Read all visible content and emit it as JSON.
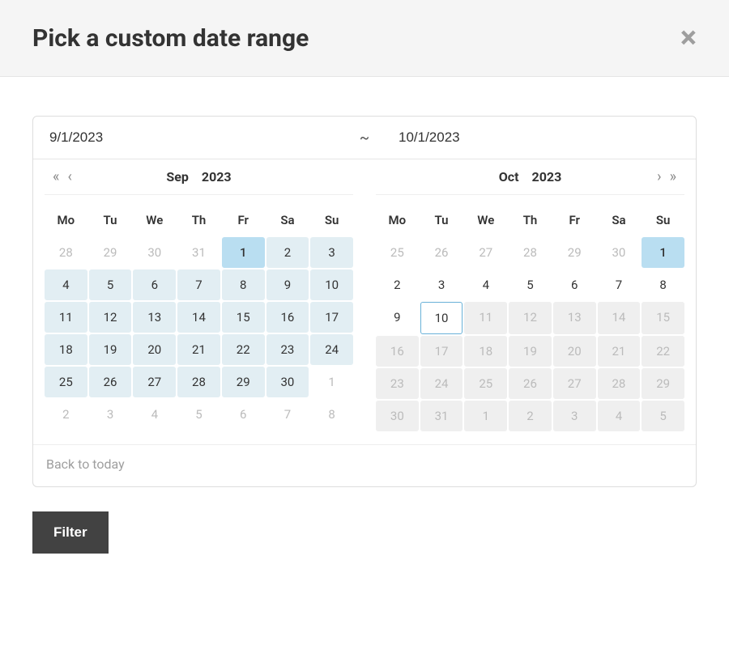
{
  "header": {
    "title": "Pick a custom date range",
    "close_glyph": "×"
  },
  "picker": {
    "start_value": "9/1/2023",
    "end_value": "10/1/2023",
    "separator": "~",
    "back_to_today": "Back to today"
  },
  "dow": [
    "Mo",
    "Tu",
    "We",
    "Th",
    "Fr",
    "Sa",
    "Su"
  ],
  "left_calendar": {
    "month": "Sep",
    "year": "2023",
    "nav_prev_year": "«",
    "nav_prev_month": "‹",
    "days": [
      {
        "n": "28",
        "cls": "other"
      },
      {
        "n": "29",
        "cls": "other"
      },
      {
        "n": "30",
        "cls": "other"
      },
      {
        "n": "31",
        "cls": "other"
      },
      {
        "n": "1",
        "cls": "selected"
      },
      {
        "n": "2",
        "cls": "in-range"
      },
      {
        "n": "3",
        "cls": "in-range"
      },
      {
        "n": "4",
        "cls": "in-range"
      },
      {
        "n": "5",
        "cls": "in-range"
      },
      {
        "n": "6",
        "cls": "in-range"
      },
      {
        "n": "7",
        "cls": "in-range"
      },
      {
        "n": "8",
        "cls": "in-range"
      },
      {
        "n": "9",
        "cls": "in-range"
      },
      {
        "n": "10",
        "cls": "in-range"
      },
      {
        "n": "11",
        "cls": "in-range"
      },
      {
        "n": "12",
        "cls": "in-range"
      },
      {
        "n": "13",
        "cls": "in-range"
      },
      {
        "n": "14",
        "cls": "in-range"
      },
      {
        "n": "15",
        "cls": "in-range"
      },
      {
        "n": "16",
        "cls": "in-range"
      },
      {
        "n": "17",
        "cls": "in-range"
      },
      {
        "n": "18",
        "cls": "in-range"
      },
      {
        "n": "19",
        "cls": "in-range"
      },
      {
        "n": "20",
        "cls": "in-range"
      },
      {
        "n": "21",
        "cls": "in-range"
      },
      {
        "n": "22",
        "cls": "in-range"
      },
      {
        "n": "23",
        "cls": "in-range"
      },
      {
        "n": "24",
        "cls": "in-range"
      },
      {
        "n": "25",
        "cls": "in-range"
      },
      {
        "n": "26",
        "cls": "in-range"
      },
      {
        "n": "27",
        "cls": "in-range"
      },
      {
        "n": "28",
        "cls": "in-range"
      },
      {
        "n": "29",
        "cls": "in-range"
      },
      {
        "n": "30",
        "cls": "in-range"
      },
      {
        "n": "1",
        "cls": "other"
      },
      {
        "n": "2",
        "cls": "other"
      },
      {
        "n": "3",
        "cls": "other"
      },
      {
        "n": "4",
        "cls": "other"
      },
      {
        "n": "5",
        "cls": "other"
      },
      {
        "n": "6",
        "cls": "other"
      },
      {
        "n": "7",
        "cls": "other"
      },
      {
        "n": "8",
        "cls": "other"
      }
    ]
  },
  "right_calendar": {
    "month": "Oct",
    "year": "2023",
    "nav_next_month": "›",
    "nav_next_year": "»",
    "days": [
      {
        "n": "25",
        "cls": "other"
      },
      {
        "n": "26",
        "cls": "other"
      },
      {
        "n": "27",
        "cls": "other"
      },
      {
        "n": "28",
        "cls": "other"
      },
      {
        "n": "29",
        "cls": "other"
      },
      {
        "n": "30",
        "cls": "other"
      },
      {
        "n": "1",
        "cls": "selected"
      },
      {
        "n": "2",
        "cls": ""
      },
      {
        "n": "3",
        "cls": ""
      },
      {
        "n": "4",
        "cls": ""
      },
      {
        "n": "5",
        "cls": ""
      },
      {
        "n": "6",
        "cls": ""
      },
      {
        "n": "7",
        "cls": ""
      },
      {
        "n": "8",
        "cls": ""
      },
      {
        "n": "9",
        "cls": ""
      },
      {
        "n": "10",
        "cls": "today"
      },
      {
        "n": "11",
        "cls": "disabled"
      },
      {
        "n": "12",
        "cls": "disabled"
      },
      {
        "n": "13",
        "cls": "disabled"
      },
      {
        "n": "14",
        "cls": "disabled"
      },
      {
        "n": "15",
        "cls": "disabled"
      },
      {
        "n": "16",
        "cls": "disabled"
      },
      {
        "n": "17",
        "cls": "disabled"
      },
      {
        "n": "18",
        "cls": "disabled"
      },
      {
        "n": "19",
        "cls": "disabled"
      },
      {
        "n": "20",
        "cls": "disabled"
      },
      {
        "n": "21",
        "cls": "disabled"
      },
      {
        "n": "22",
        "cls": "disabled"
      },
      {
        "n": "23",
        "cls": "disabled"
      },
      {
        "n": "24",
        "cls": "disabled"
      },
      {
        "n": "25",
        "cls": "disabled"
      },
      {
        "n": "26",
        "cls": "disabled"
      },
      {
        "n": "27",
        "cls": "disabled"
      },
      {
        "n": "28",
        "cls": "disabled"
      },
      {
        "n": "29",
        "cls": "disabled"
      },
      {
        "n": "30",
        "cls": "disabled"
      },
      {
        "n": "31",
        "cls": "disabled"
      },
      {
        "n": "1",
        "cls": "disabled"
      },
      {
        "n": "2",
        "cls": "disabled"
      },
      {
        "n": "3",
        "cls": "disabled"
      },
      {
        "n": "4",
        "cls": "disabled"
      },
      {
        "n": "5",
        "cls": "disabled"
      }
    ]
  },
  "filter_button": "Filter"
}
